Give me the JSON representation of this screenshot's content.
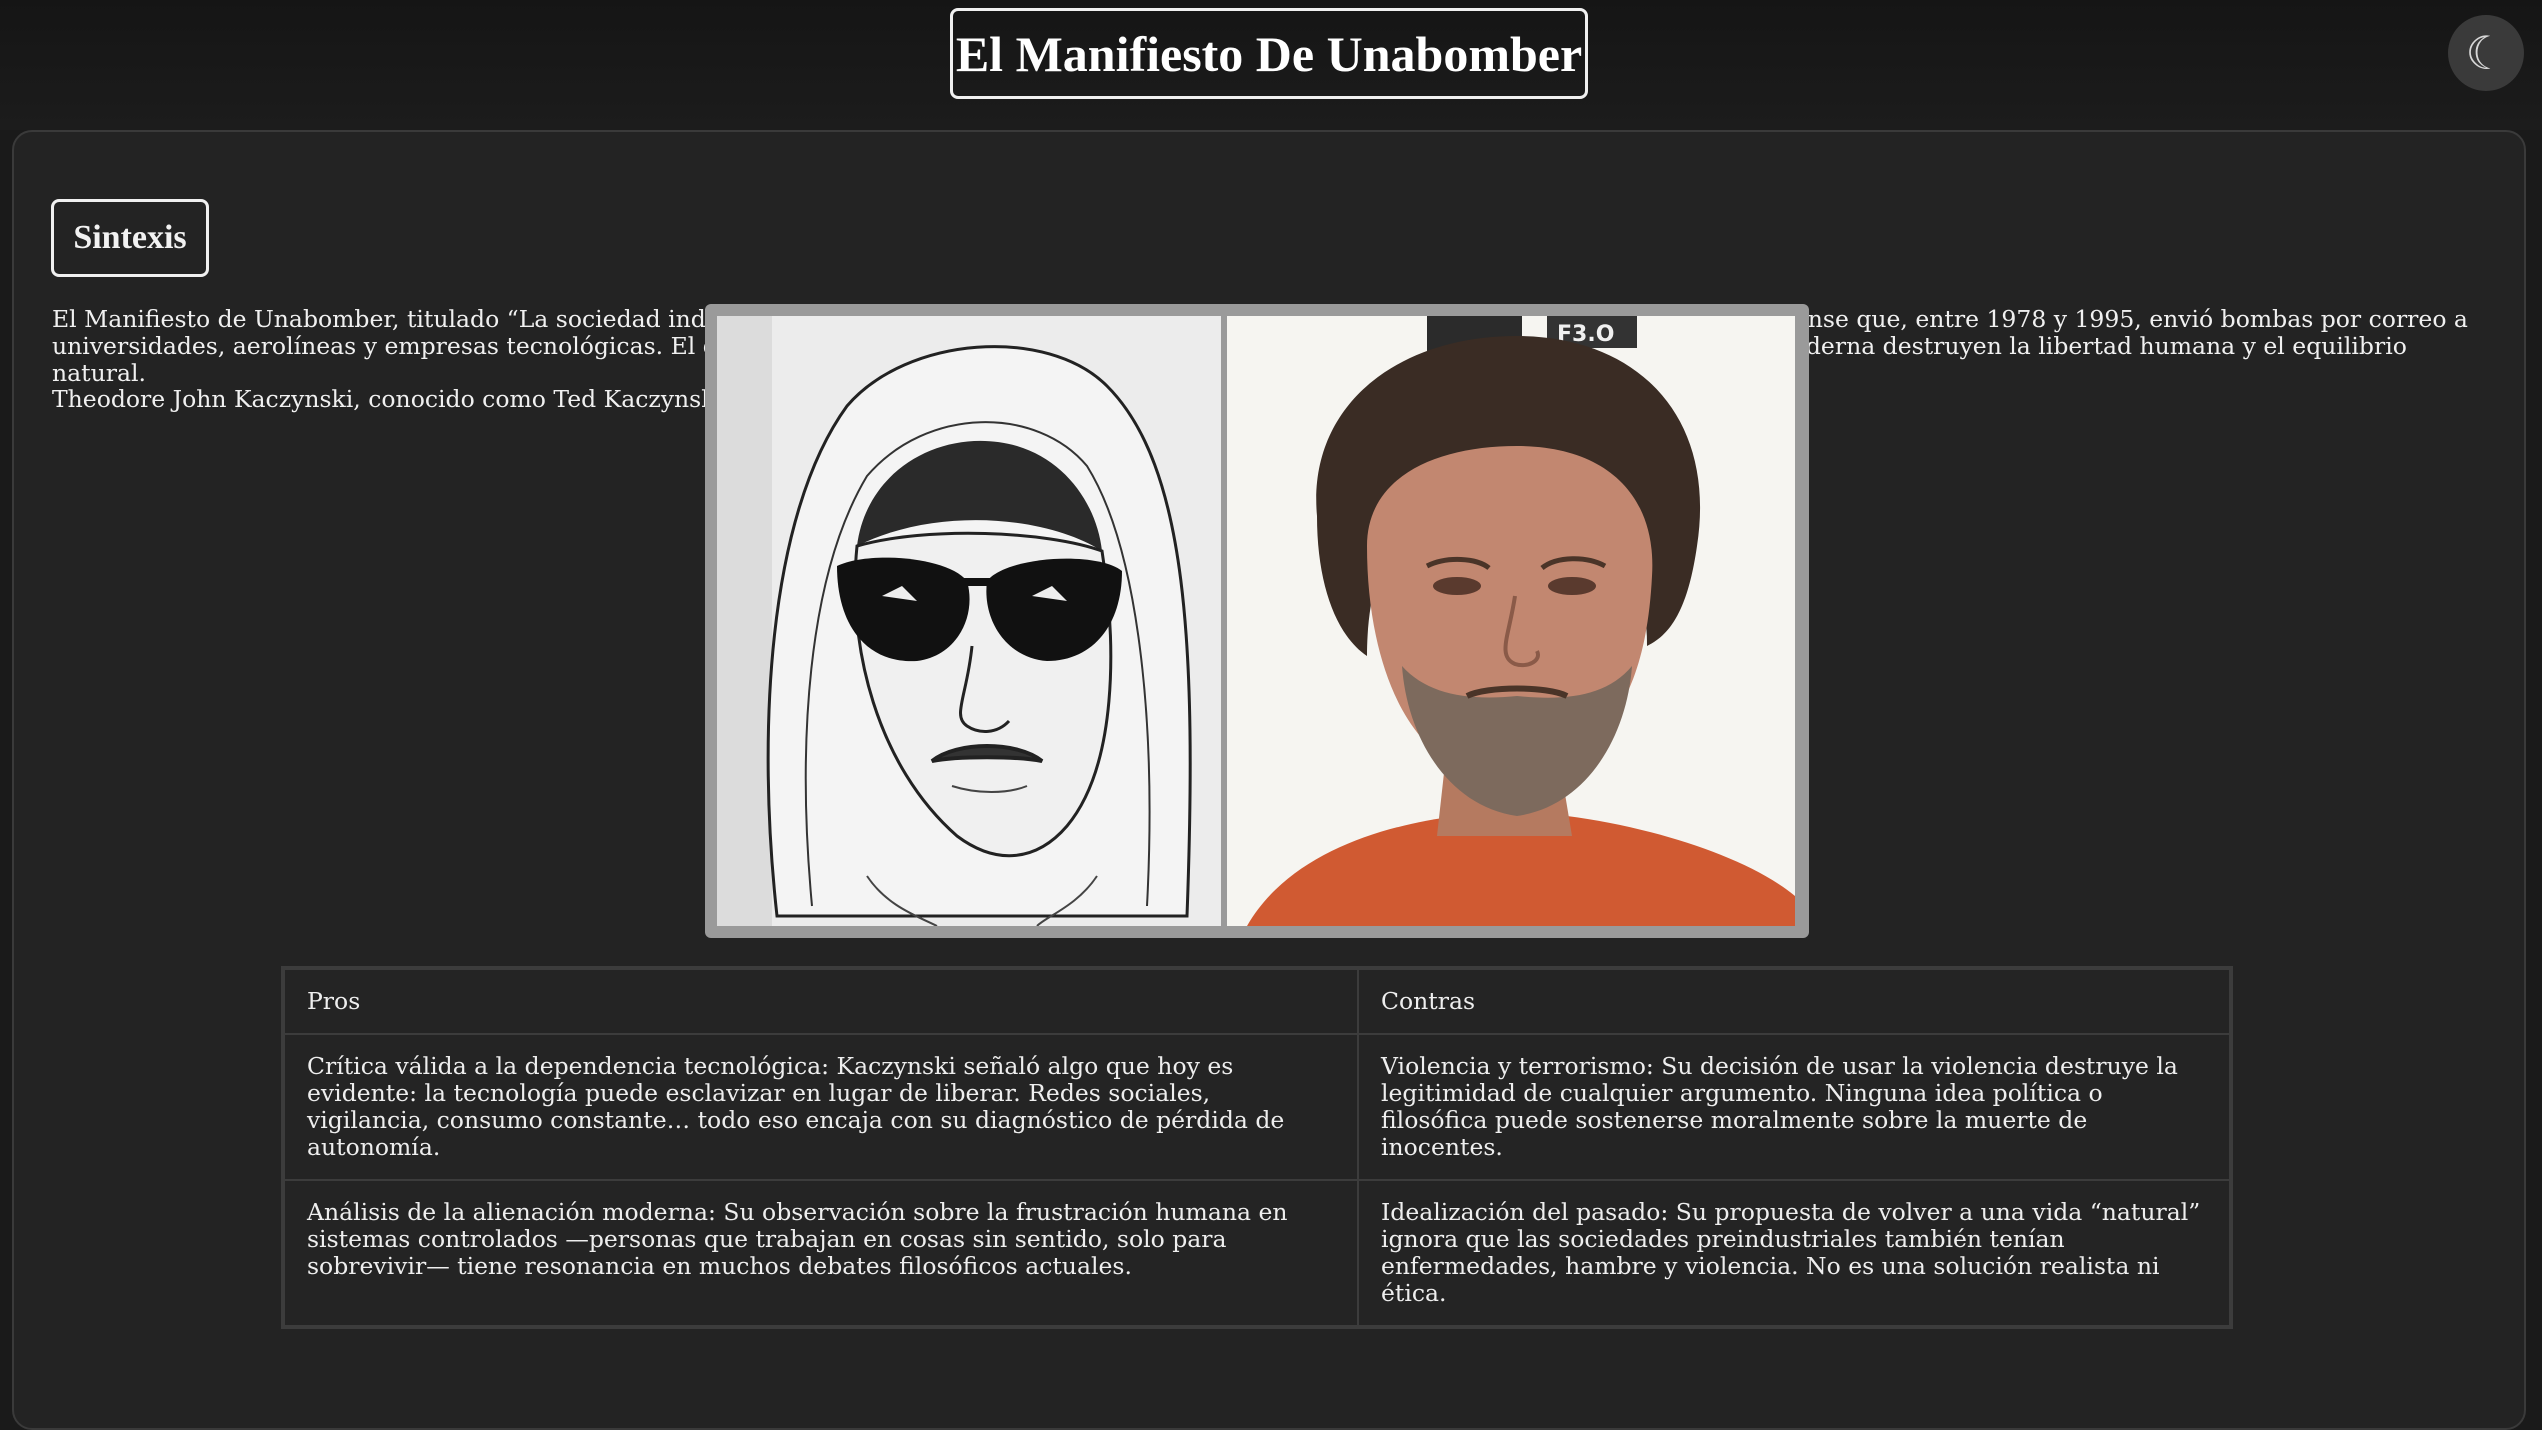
{
  "header": {
    "title": "El Manifiesto De Unabomber",
    "theme_toggle_icon": "moon-icon",
    "theme_toggle_glyph": "☾"
  },
  "section": {
    "heading": "Sintexis",
    "paragraphs": [
      "El Manifiesto de Unabomber, titulado “La sociedad industrial y su futuro”, es un texto escrito por Theodore Kaczynski, un matemático estadounidense que, entre 1978 y 1995, envió bombas por correo a universidades, aerolíneas y empresas tecnológicas. El documento expone sus ideas sobre cómo el progreso tecnológico y la sociedad industrial moderna destruyen la libertad humana y el equilibrio natural.",
      "Theodore John Kaczynski, conocido como Ted Kaczynski o el Unabomber, nació el 22 de mayo de 1942 en Chicago, Illinois, Estados Unidos."
    ]
  },
  "image": {
    "left": "composite-sketch-hooded-man-sunglasses",
    "right": "mugshot-bearded-man-orange-shirt",
    "mugshot_sign": "F3.O"
  },
  "table": {
    "headers": [
      "Pros",
      "Contras"
    ],
    "rows": [
      [
        "Crítica válida a la dependencia tecnológica: Kaczynski señaló algo que hoy es evidente: la tecnología puede esclavizar en lugar de liberar. Redes sociales, vigilancia, consumo constante… todo eso encaja con su diagnóstico de pérdida de autonomía.",
        "Violencia y terrorismo: Su decisión de usar la violencia destruye la legitimidad de cualquier argumento. Ninguna idea política o filosófica puede sostenerse moralmente sobre la muerte de inocentes."
      ],
      [
        "Análisis de la alienación moderna: Su observación sobre la frustración humana en sistemas controlados —personas que trabajan en cosas sin sentido, solo para sobrevivir— tiene resonancia en muchos debates filosóficos actuales.",
        "Idealización del pasado: Su propuesta de volver a una vida “natural” ignora que las sociedades preindustriales también tenían enfermedades, hambre y violencia. No es una solución realista ni ética."
      ]
    ]
  },
  "colors": {
    "background": "#1a1a1a",
    "panel": "#232323",
    "text": "#f0f0f0",
    "border": "#3c3c3c"
  }
}
